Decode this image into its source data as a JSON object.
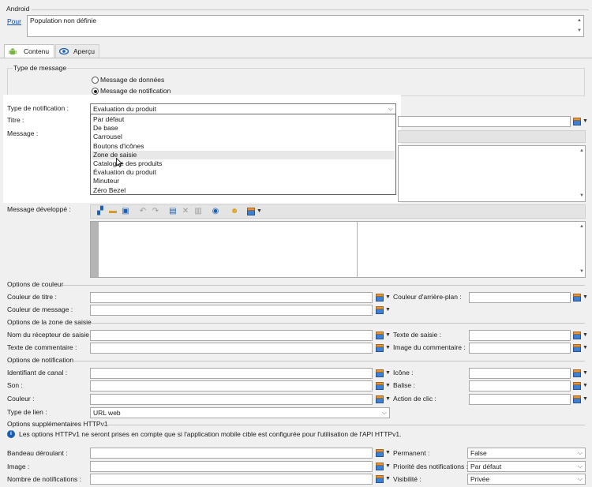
{
  "section_android": "Android",
  "pour": {
    "link": "Pour",
    "value": "Population non définie"
  },
  "tabs": [
    {
      "label": "Contenu",
      "icon": "android-icon"
    },
    {
      "label": "Aperçu",
      "icon": "eye-icon"
    }
  ],
  "message_type": {
    "legend": "Type de message",
    "options": [
      "Message de données",
      "Message de notification"
    ],
    "selected": "Message de notification"
  },
  "notification_type": {
    "label": "Type de notification :",
    "value": "Evaluation du produit",
    "dropdown_options": [
      "Par défaut",
      "De base",
      "Carrousel",
      "Boutons d'icônes",
      "Zone de saisie",
      "Catalogue des produits",
      "Évaluation du produit",
      "Minuteur",
      "Zéro Bezel"
    ],
    "hovered": "Zone de saisie"
  },
  "fields": {
    "titre": "Titre :",
    "message": "Message :",
    "message_developpe": "Message développé :"
  },
  "colors_section": {
    "title": "Options de couleur",
    "couleur_titre": "Couleur de titre :",
    "couleur_arriere_plan": "Couleur d'arrière-plan :",
    "couleur_message": "Couleur de message :"
  },
  "input_zone_section": {
    "title": "Options de la zone de saisie",
    "nom_recepteur": "Nom du récepteur de saisie :",
    "texte_saisie": "Texte de saisie :",
    "texte_commentaire": "Texte de commentaire :",
    "image_commentaire": "Image du commentaire :"
  },
  "notification_section": {
    "title": "Options de notification",
    "identifiant_canal": "Identifiant de canal :",
    "icone": "Icône :",
    "son": "Son :",
    "balise": "Balise :",
    "couleur": "Couleur :",
    "action_clic": "Action de clic :",
    "type_lien": "Type de lien :",
    "type_lien_value": "URL web"
  },
  "httpv1_section": {
    "title": "Options supplémentaires HTTPv1",
    "info": "Les options HTTPv1 ne seront prises en compte que si l'application mobile cible est configurée pour l'utilisation de l'API HTTPv1.",
    "bandeau": "Bandeau déroulant :",
    "permanent": "Permanent :",
    "permanent_value": "False",
    "image": "Image :",
    "priorite": "Priorité des notifications :",
    "priorite_value": "Par défaut",
    "nombre": "Nombre de notifications :",
    "visibilite": "Visibilité :",
    "visibilite_value": "Privée"
  },
  "colors": {
    "accent": "#1a5fb4",
    "link": "#0645ad"
  }
}
